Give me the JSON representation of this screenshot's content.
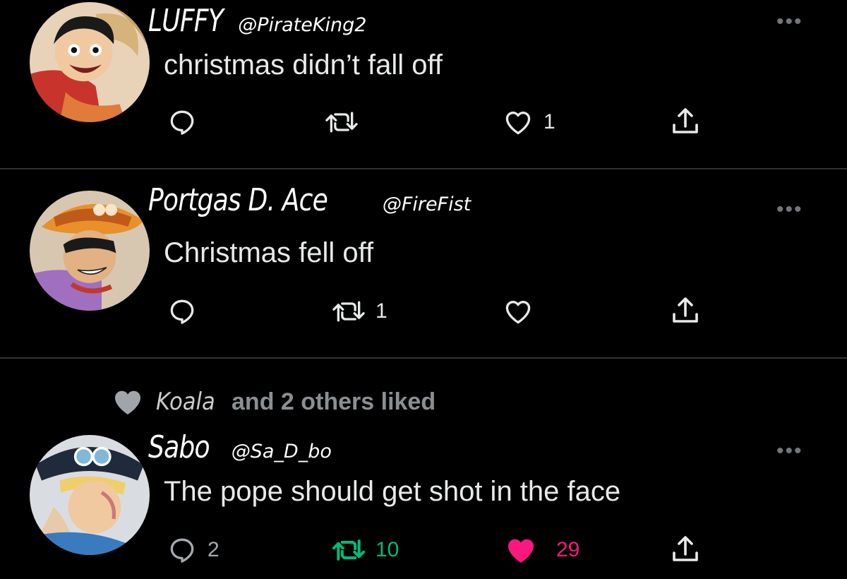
{
  "tweets": [
    {
      "display_name": "LUFFY",
      "handle": "@PirateKing2",
      "text": "christmas didn’t fall off",
      "reply_count": "",
      "retweet_count": "",
      "like_count": "1",
      "liked": false,
      "retweeted": false
    },
    {
      "display_name": "Portgas D. Ace",
      "handle": "@FireFist",
      "text": "Christmas fell off",
      "reply_count": "",
      "retweet_count": "1",
      "like_count": "",
      "liked": false,
      "retweeted": false
    },
    {
      "social_context": {
        "user": "Koala",
        "text": "and 2 others liked"
      },
      "display_name": "Sabo",
      "handle": "@Sa_D_bo",
      "text": "The pope should get shot in the face",
      "reply_count": "2",
      "retweet_count": "10",
      "like_count": "29",
      "liked": true,
      "retweeted": true
    }
  ],
  "more_label": "•••",
  "icons": {
    "reply": "reply-icon",
    "retweet": "retweet-icon",
    "like": "heart-icon",
    "share": "share-icon",
    "more": "more-icon"
  },
  "colors": {
    "background": "#000000",
    "text": "#e7e9ea",
    "muted": "#71767b",
    "liked": "#f91880",
    "retweeted": "#00ba7c",
    "divider": "#2f3336"
  }
}
